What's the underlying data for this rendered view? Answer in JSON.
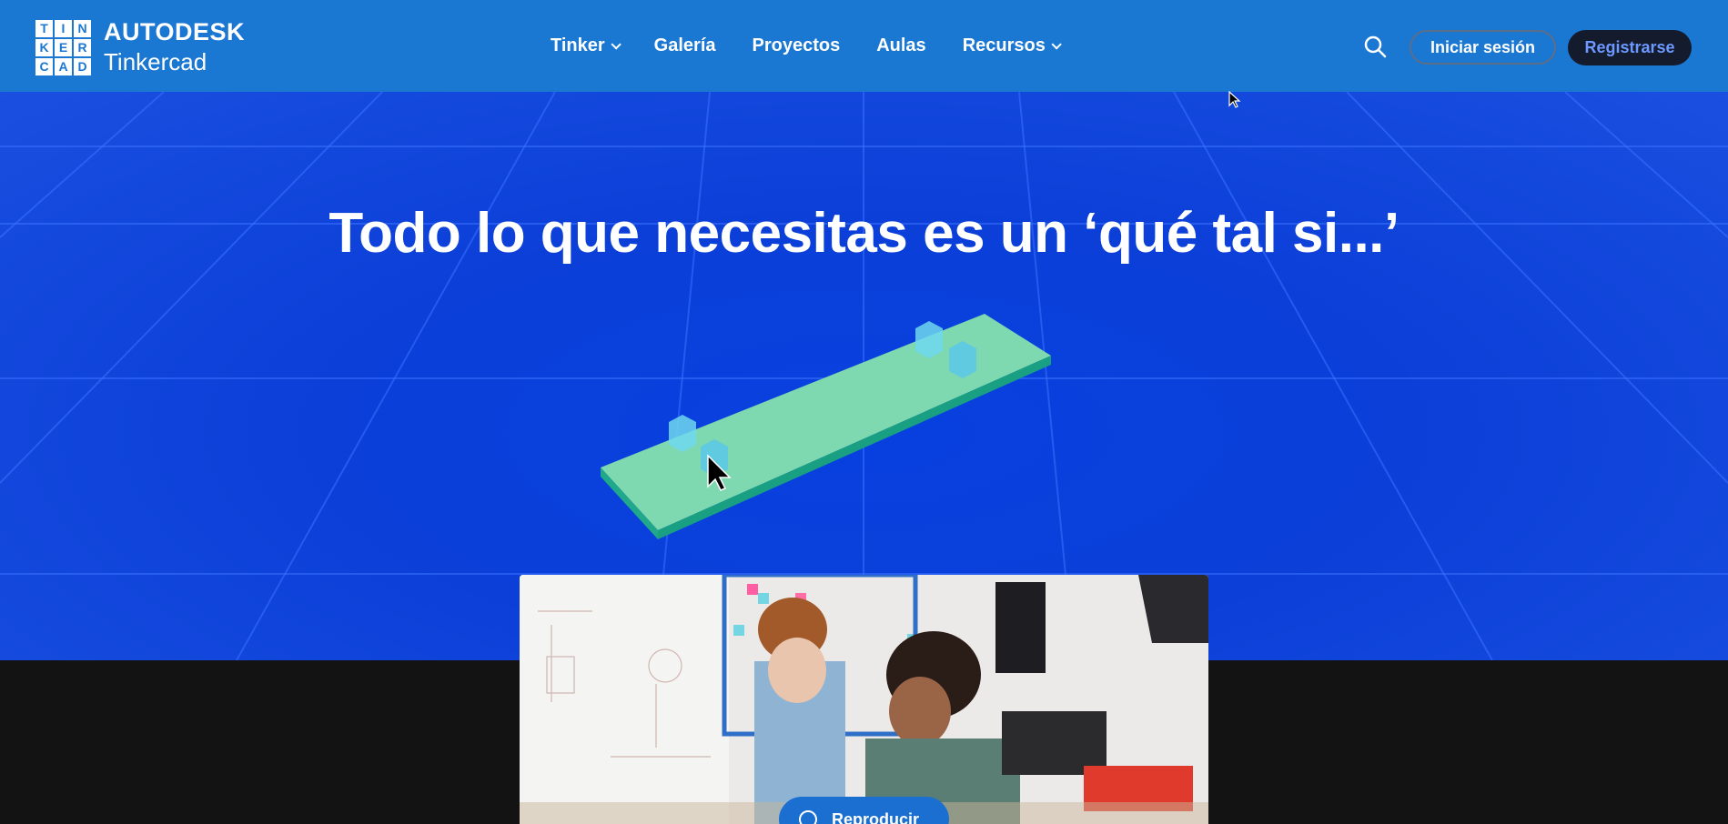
{
  "header": {
    "logo_letters": [
      "T",
      "I",
      "N",
      "K",
      "E",
      "R",
      "C",
      "A",
      "D"
    ],
    "brand_line1": "AUTODESK",
    "brand_line2": "Tinkercad",
    "nav": [
      {
        "label": "Tinker",
        "has_dropdown": true
      },
      {
        "label": "Galería",
        "has_dropdown": false
      },
      {
        "label": "Proyectos",
        "has_dropdown": false
      },
      {
        "label": "Aulas",
        "has_dropdown": false
      },
      {
        "label": "Recursos",
        "has_dropdown": true
      }
    ],
    "search_icon": "search-icon",
    "login_label": "Iniciar sesión",
    "signup_label": "Registrarse"
  },
  "hero": {
    "title": "Todo lo que necesitas es un ‘qué tal si...’"
  },
  "video": {
    "play_label": "Reproducir",
    "play_icon": "play-icon"
  },
  "colors": {
    "header_bg": "#1a77d2",
    "hero_bg": "#0b3fd8",
    "dark_band": "#131313",
    "signup_bg": "#141b2d",
    "signup_text": "#6c99ff",
    "board_top": "#7fd9b0",
    "board_side": "#1fa98a"
  }
}
